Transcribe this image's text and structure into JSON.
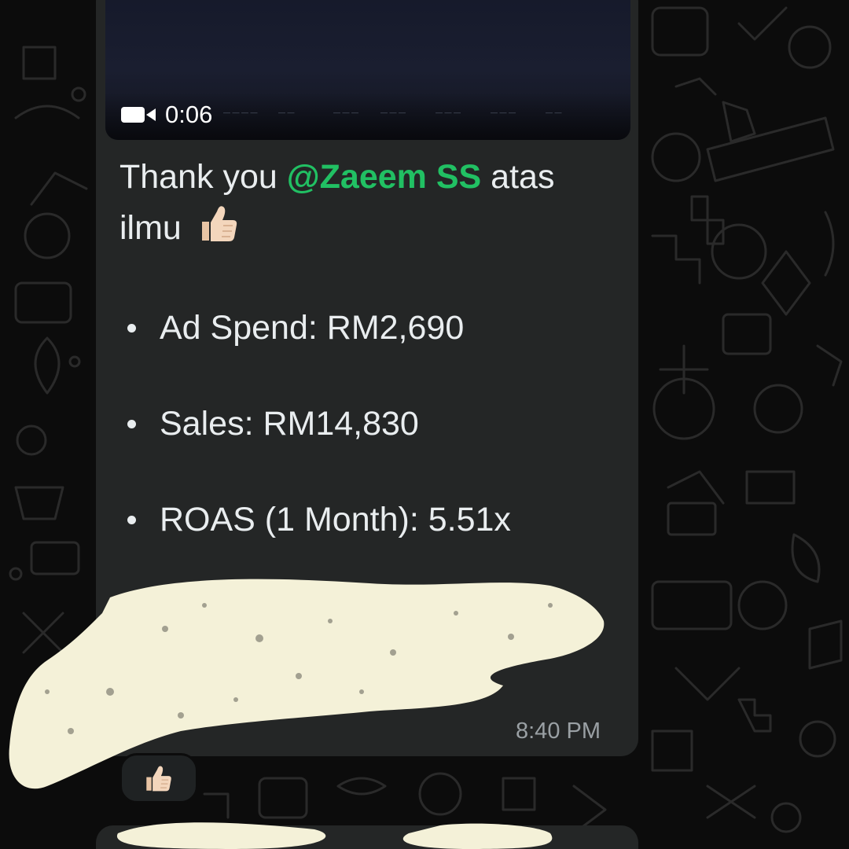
{
  "video": {
    "duration": "0:06",
    "icon": "video-camera-icon"
  },
  "message": {
    "greeting": "Thank you ",
    "mention": "@Zaeem SS",
    "after_mention": " atas",
    "line2": "ilmu",
    "emoji": "thumbs-up-icon",
    "stats": [
      {
        "label": "Ad Spend: RM2,690"
      },
      {
        "label": "Sales: RM14,830"
      },
      {
        "label": "ROAS (1 Month): 5.51x"
      }
    ],
    "time": "8:40 PM"
  },
  "reaction": {
    "emoji": "thumbs-up-icon"
  },
  "colors": {
    "mention": "#21c063",
    "bubble": "#242626",
    "background": "#0c0c0c",
    "text": "#e9edef",
    "timestamp": "#9aa0a4",
    "redaction": "#f4f1d8"
  }
}
